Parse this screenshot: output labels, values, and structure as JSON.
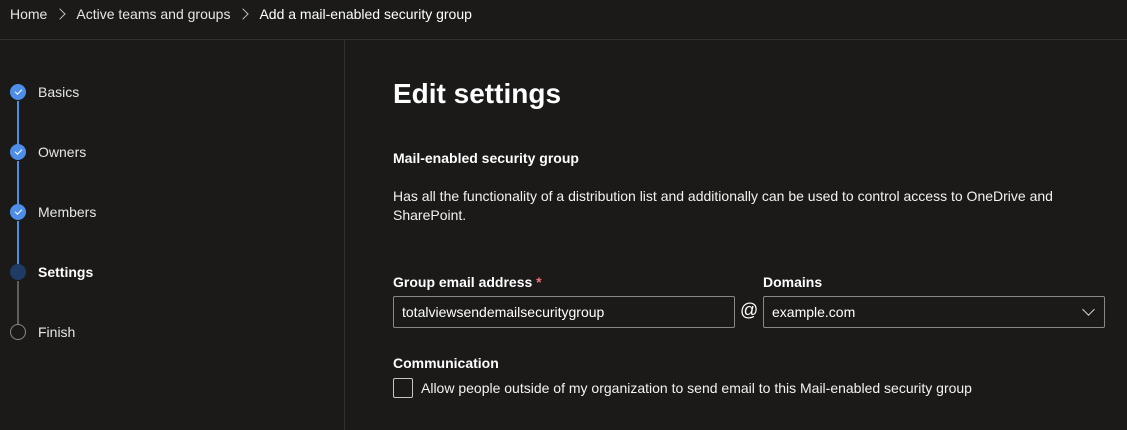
{
  "breadcrumb": {
    "items": [
      "Home",
      "Active teams and groups",
      "Add a mail-enabled security group"
    ]
  },
  "steps": [
    {
      "label": "Basics",
      "state": "done"
    },
    {
      "label": "Owners",
      "state": "done"
    },
    {
      "label": "Members",
      "state": "done"
    },
    {
      "label": "Settings",
      "state": "current"
    },
    {
      "label": "Finish",
      "state": "todo"
    }
  ],
  "main": {
    "title": "Edit settings",
    "section_title": "Mail-enabled security group",
    "description": "Has all the functionality of a distribution list and additionally can be used to control access to OneDrive and SharePoint.",
    "email_label": "Group email address",
    "required_marker": "*",
    "email_value": "totalviewsendemailsecuritygroup",
    "at_symbol": "@",
    "domains_label": "Domains",
    "domain_value": "example.com",
    "communication_label": "Communication",
    "checkbox_label": "Allow people outside of my organization to send email to this Mail-enabled security group",
    "checkbox_checked": false
  },
  "colors": {
    "background": "#1b1a19",
    "accent": "#4f8ee8",
    "required": "#f1707b",
    "divider": "#323130"
  }
}
